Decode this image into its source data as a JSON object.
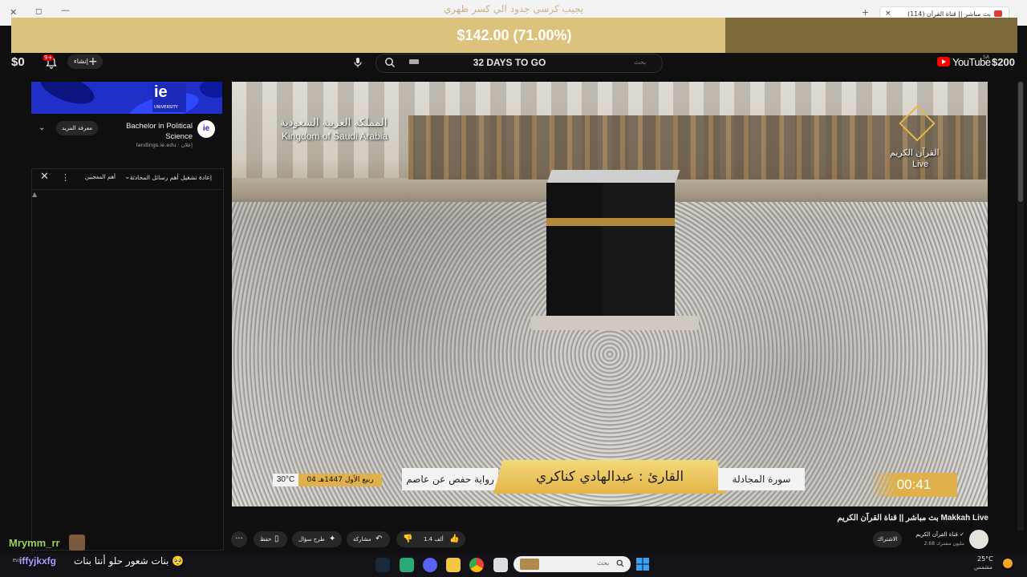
{
  "browser": {
    "title_text": "يجيب كرسي جدود الي كسر ظهري",
    "tab_title": "(114) بث مباشر || قناة القرآن",
    "tab_close": "×",
    "new_tab": "+",
    "close_glyph": "✕",
    "restore_glyph": "◻",
    "minimize_glyph": "—"
  },
  "donation_goal": {
    "text": "$142.00 (71.00%)",
    "progress_fraction": 0.71,
    "fill_color": "#dcc27c"
  },
  "header": {
    "money_left": "$0",
    "money_right": "$200",
    "bell_badge": "9+",
    "create_label": "إنشاء",
    "create_plus": "+",
    "countdown": "32 DAYS TO GO",
    "search_placeholder": "بحث",
    "logo_word": "YouTube",
    "logo_region": "SA"
  },
  "ad": {
    "logo_text": "ie",
    "logo_sub": "UNIVERSITY",
    "avatar_text": "ie",
    "title": "Bachelor in Political Science",
    "url": "landings.ie.edu · إعلان",
    "more_label": "معرفة المزيد",
    "chevron": "⌄"
  },
  "chat_panel": {
    "title": "إعادة تشغيل أهم رسائل المحادثة",
    "chevron": "⌄",
    "top_label": "أهم المعجبين",
    "menu": "⋮",
    "close": "✕",
    "arrow": "▲"
  },
  "video": {
    "watermark_ar": "المملكة العربية السعودية",
    "watermark_en": "Kingdom of Saudi Arabia",
    "channel_logo_ar": "القرآن الكريم",
    "channel_logo_live": "Live",
    "lower_third": {
      "temperature": "30°C",
      "date": "04 ربيع الأول 1447هـ",
      "riwaya": "رواية حفص عن عاصم",
      "reader": "القارئ : عبدالهادي كناكري",
      "surah": "سورة المجادلة",
      "time": "00:41"
    }
  },
  "video_info": {
    "title": "بث مباشر || قناة القرآن الكريم Makkah Live",
    "channel_name": "قناة القرآن الكريم ✓",
    "channel_subs": "2.68 مليون مشترك",
    "subscribe_label": "الاشتراك",
    "like_count": "1.4 ألف",
    "share_label": "مشاركة",
    "ask_label": "طرح سؤال",
    "save_label": "حفظ",
    "more_label": "···"
  },
  "stream_overlay": {
    "streamer_name": "Mrymm_rr",
    "chat_user": "iffyjkxfg",
    "chat_message": "بنات شعور حلو أنتا بنات 🥺",
    "chat_meta": "EV/N"
  },
  "taskbar": {
    "search_placeholder": "بحث",
    "weather_temp": "25°C",
    "weather_desc": "مشمس"
  },
  "colors": {
    "accent_gold": "#e0b14a",
    "youtube_red": "#ff0000",
    "bg_dark": "#0f0f0f"
  }
}
